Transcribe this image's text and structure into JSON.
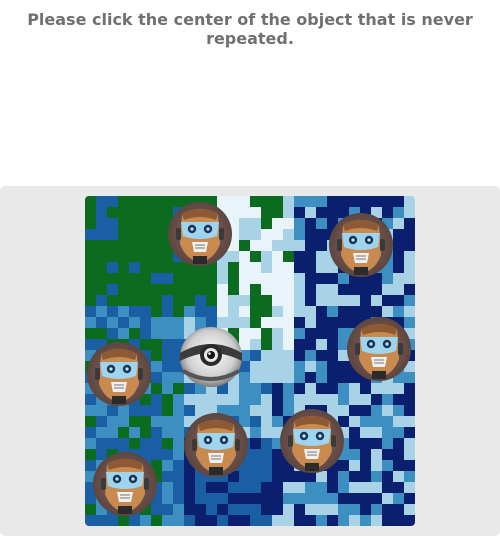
{
  "prompt": "Please click the center of the object that is never repeated.",
  "board": {
    "background_colors": [
      "#0b6b1e",
      "#1a5fa3",
      "#a8d2e6",
      "#0a1f6e",
      "#3d8fc2",
      "#e8f4fa"
    ],
    "objects": [
      {
        "kind": "robot-head-icon",
        "repeated": true
      },
      {
        "kind": "robot-head-icon",
        "repeated": true
      },
      {
        "kind": "robot-head-icon",
        "repeated": true
      },
      {
        "kind": "robot-head-icon",
        "repeated": true
      },
      {
        "kind": "robot-head-icon",
        "repeated": true
      },
      {
        "kind": "robot-head-icon",
        "repeated": true
      },
      {
        "kind": "robot-head-icon",
        "repeated": true
      },
      {
        "kind": "eye-pod-icon",
        "repeated": false
      }
    ]
  }
}
